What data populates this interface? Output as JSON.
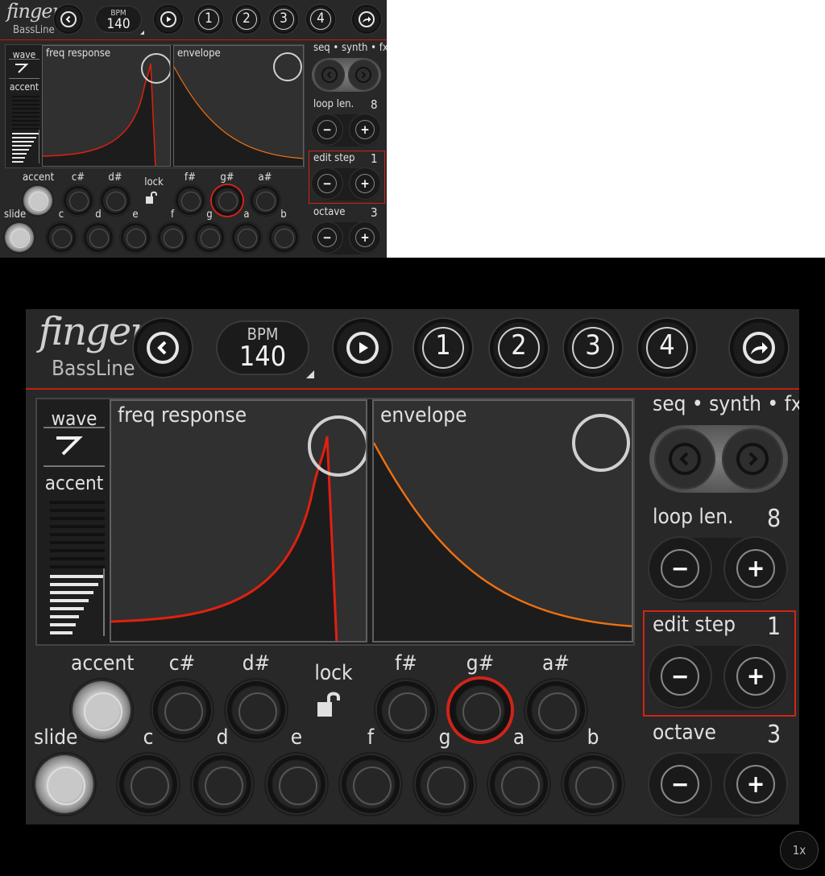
{
  "app": {
    "logo_main": "finger",
    "logo_sub": "BassLine"
  },
  "toolbar": {
    "back_icon": "chevron-left-icon",
    "bpm_label": "BPM",
    "bpm_value": "140",
    "play_icon": "play-icon",
    "patterns": [
      "1",
      "2",
      "3",
      "4"
    ],
    "share_icon": "share-arrow-icon"
  },
  "display": {
    "wave_label": "wave",
    "accent_label": "accent",
    "freq_label": "freq response",
    "envelope_label": "envelope"
  },
  "keyboard": {
    "accent_label": "accent",
    "slide_label": "slide",
    "lock_label": "lock",
    "sharps": [
      "c#",
      "d#",
      "f#",
      "g#",
      "a#"
    ],
    "naturals": [
      "c",
      "d",
      "e",
      "f",
      "g",
      "a",
      "b"
    ]
  },
  "controls": {
    "nav_label": "seq • synth • fx",
    "loop_label": "loop len.",
    "loop_value": "8",
    "edit_label": "edit step",
    "edit_value": "1",
    "octave_label": "octave",
    "octave_value": "3",
    "minus": "−",
    "plus": "+"
  },
  "zoom": "1x",
  "colors": {
    "accent_red": "#d02418",
    "filter_curve": "#e02010",
    "envelope_curve": "#f07010",
    "panel_bg": "#282828"
  }
}
